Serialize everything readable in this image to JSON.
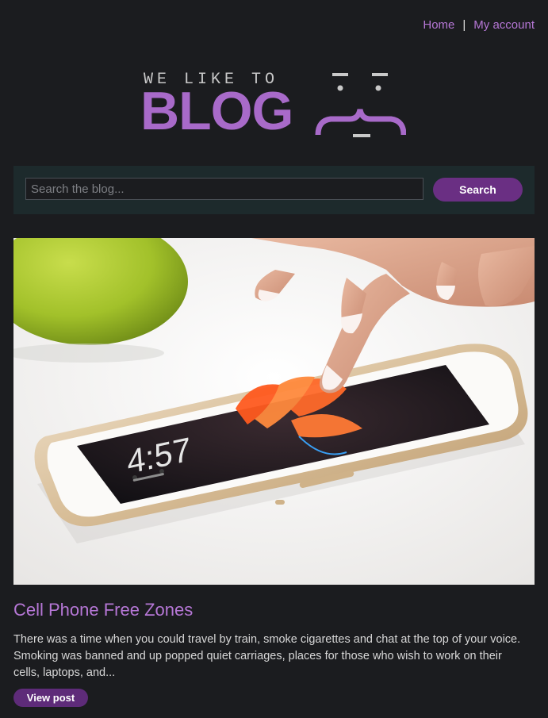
{
  "nav": {
    "home_label": "Home",
    "separator": "|",
    "account_label": "My account",
    "link_color": "#b677d6"
  },
  "logo": {
    "tagline": "WE LIKE TO",
    "word": "BLOG",
    "brand_color": "#a86ac9"
  },
  "search": {
    "placeholder": "Search the blog...",
    "value": "",
    "button_label": "Search"
  },
  "post": {
    "image_icon": "phone-photo",
    "title": "Cell Phone Free Zones",
    "excerpt": "There was a time when you could travel by train, smoke cigarettes and chat at the top of your voice. Smoking was banned and up popped quiet carriages, places for those who wish to work on their cells, laptops, and...",
    "view_label": "View post",
    "phone_time": "4:57"
  },
  "colors": {
    "background": "#1b1c1f",
    "search_panel": "#1d2a2c",
    "accent_button": "#6a2f83"
  }
}
